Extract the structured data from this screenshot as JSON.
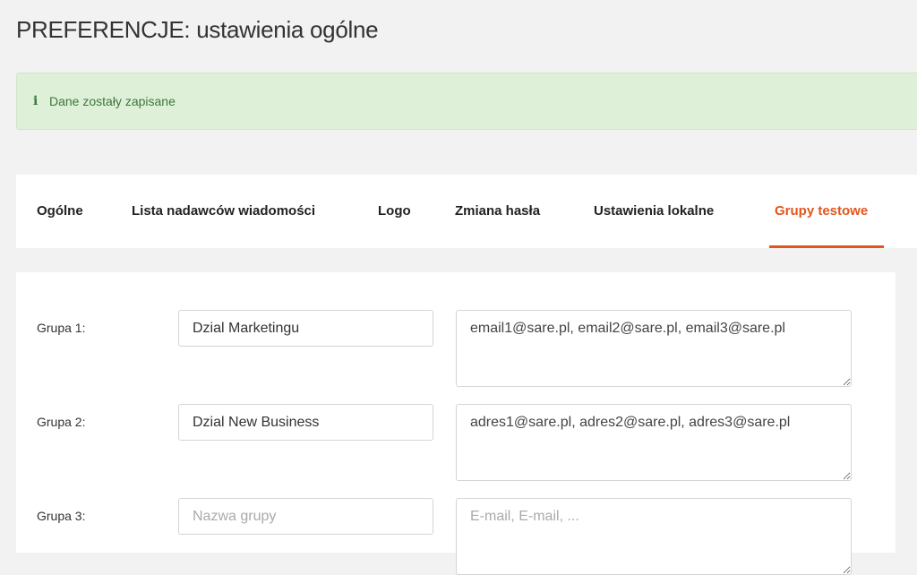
{
  "page": {
    "title": "PREFERENCJE: ustawienia ogólne"
  },
  "alert": {
    "icon": "info-icon",
    "message": "Dane zostały zapisane",
    "color": "#3c763d",
    "background": "#dff0d8"
  },
  "tabs": [
    {
      "label": "Ogólne",
      "active": false
    },
    {
      "label": "Lista nadawców wiadomości",
      "active": false
    },
    {
      "label": "Logo",
      "active": false
    },
    {
      "label": "Zmiana hasła",
      "active": false
    },
    {
      "label": "Ustawienia lokalne",
      "active": false
    },
    {
      "label": "Grupy testowe",
      "active": true
    }
  ],
  "accent_color": "#e2561e",
  "groups": [
    {
      "label": "Grupa 1:",
      "name_value": "Dzial Marketingu",
      "name_placeholder": "Nazwa grupy",
      "emails_value": "email1@sare.pl, email2@sare.pl, email3@sare.pl",
      "emails_placeholder": "E-mail, E-mail, ..."
    },
    {
      "label": "Grupa 2:",
      "name_value": "Dzial New Business",
      "name_placeholder": "Nazwa grupy",
      "emails_value": "adres1@sare.pl, adres2@sare.pl, adres3@sare.pl",
      "emails_placeholder": "E-mail, E-mail, ..."
    },
    {
      "label": "Grupa 3:",
      "name_value": "",
      "name_placeholder": "Nazwa grupy",
      "emails_value": "",
      "emails_placeholder": "E-mail, E-mail, ..."
    }
  ]
}
